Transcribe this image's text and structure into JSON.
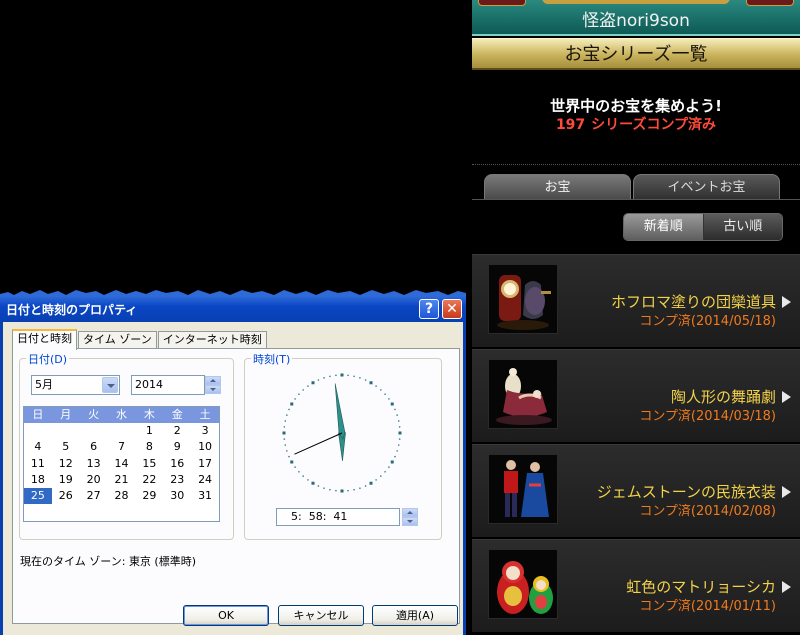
{
  "game": {
    "username": "怪盗nori9son",
    "page_title": "お宝シリーズ一覧",
    "headline": "世界中のお宝を集めよう!",
    "complete_count": "197",
    "complete_suffix": "シリーズコンプ済み",
    "tabs": [
      {
        "label": "お宝"
      },
      {
        "label": "イベントお宝"
      }
    ],
    "sort": [
      {
        "label": "新着順"
      },
      {
        "label": "古い順"
      }
    ],
    "series": [
      {
        "name": "ホフロマ塗りの団欒道具",
        "status": "コンプ済(2014/05/18)"
      },
      {
        "name": "陶人形の舞踊劇",
        "status": "コンプ済(2014/03/18)"
      },
      {
        "name": "ジェムストーンの民族衣装",
        "status": "コンプ済(2014/02/08)"
      },
      {
        "name": "虹色のマトリョーシカ",
        "status": "コンプ済(2014/01/11)"
      }
    ]
  },
  "dialog": {
    "title": "日付と時刻のプロパティ",
    "help_glyph": "?",
    "close_glyph": "✕",
    "tabs": [
      {
        "label": "日付と時刻"
      },
      {
        "label": "タイム ゾーン"
      },
      {
        "label": "インターネット時刻"
      }
    ],
    "date_group_label": "日付(D)",
    "time_group_label": "時刻(T)",
    "month_value": "5月",
    "year_value": "2014",
    "weekdays": [
      "日",
      "月",
      "火",
      "水",
      "木",
      "金",
      "土"
    ],
    "calendar_rows": [
      [
        "",
        "",
        "",
        "",
        "1",
        "2",
        "3"
      ],
      [
        "4",
        "5",
        "6",
        "7",
        "8",
        "9",
        "10"
      ],
      [
        "11",
        "12",
        "13",
        "14",
        "15",
        "16",
        "17"
      ],
      [
        "18",
        "19",
        "20",
        "21",
        "22",
        "23",
        "24"
      ],
      [
        "25",
        "26",
        "27",
        "28",
        "29",
        "30",
        "31"
      ]
    ],
    "selected_day": "25",
    "time_value": "5:  58:  41",
    "timezone_label": "現在のタイム ゾーン:",
    "timezone_value": "東京 (標準時)",
    "buttons": {
      "ok": "OK",
      "cancel": "キャンセル",
      "apply": "適用(A)"
    }
  }
}
